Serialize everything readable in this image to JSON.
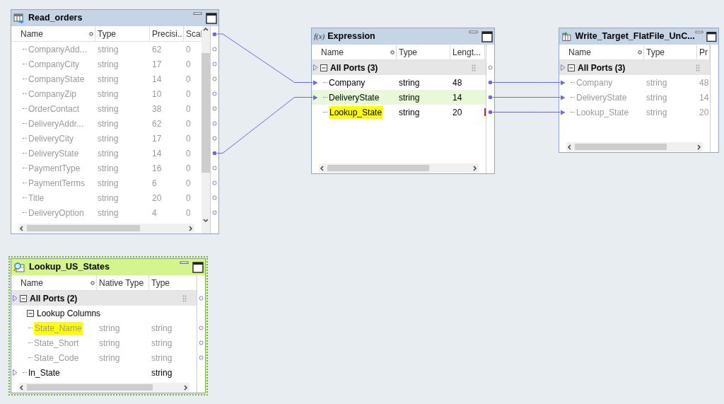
{
  "nodes": [
    {
      "kind": "source",
      "title": "Read_orders",
      "selected": false,
      "header_output_linked": true,
      "columns": [
        "Name",
        "Type",
        "Precisi...",
        "Scal"
      ],
      "rows": [
        {
          "kind": "port",
          "cells": [
            "CompanyAdd...",
            "string",
            "62",
            "0"
          ],
          "dimmed": true,
          "output": true,
          "output_linked": false
        },
        {
          "kind": "port",
          "cells": [
            "CompanyCity",
            "string",
            "17",
            "0"
          ],
          "dimmed": true,
          "output": true,
          "output_linked": false
        },
        {
          "kind": "port",
          "cells": [
            "CompanyState",
            "string",
            "14",
            "0"
          ],
          "dimmed": true,
          "output": true,
          "output_linked": false
        },
        {
          "kind": "port",
          "cells": [
            "CompanyZip",
            "string",
            "10",
            "0"
          ],
          "dimmed": true,
          "output": true,
          "output_linked": false
        },
        {
          "kind": "port",
          "cells": [
            "OrderContact",
            "string",
            "38",
            "0"
          ],
          "dimmed": true,
          "output": true,
          "output_linked": false
        },
        {
          "kind": "port",
          "cells": [
            "DeliveryAddr...",
            "string",
            "62",
            "0"
          ],
          "dimmed": true,
          "output": true,
          "output_linked": false
        },
        {
          "kind": "port",
          "cells": [
            "DeliveryCity",
            "string",
            "17",
            "0"
          ],
          "dimmed": true,
          "output": true,
          "output_linked": false
        },
        {
          "kind": "port",
          "cells": [
            "DeliveryState",
            "string",
            "14",
            "0"
          ],
          "dimmed": true,
          "output": true,
          "output_linked": true
        },
        {
          "kind": "port",
          "cells": [
            "PaymentType",
            "string",
            "16",
            "0"
          ],
          "dimmed": true,
          "output": true,
          "output_linked": false
        },
        {
          "kind": "port",
          "cells": [
            "PaymentTerms",
            "string",
            "6",
            "0"
          ],
          "dimmed": true,
          "output": true,
          "output_linked": false
        },
        {
          "kind": "port",
          "cells": [
            "Title",
            "string",
            "20",
            "0"
          ],
          "dimmed": true,
          "output": true,
          "output_linked": false
        },
        {
          "kind": "port",
          "cells": [
            "DeliveryOption",
            "string",
            "4",
            "0"
          ],
          "dimmed": true,
          "output": true,
          "output_linked": false
        }
      ]
    },
    {
      "kind": "expression",
      "title": "Expression",
      "icon_label": "f(x)",
      "selected": false,
      "columns": [
        "Name",
        "Type",
        "Lengt..."
      ],
      "rows": [
        {
          "kind": "group",
          "label": "All Ports (3)",
          "input": true,
          "input_linked": false,
          "output": true,
          "output_linked": false,
          "children": [
            {
              "kind": "port",
              "cells": [
                "Company",
                "string",
                "48"
              ],
              "input": true,
              "input_linked": true,
              "output": true,
              "output_linked": true
            },
            {
              "kind": "port",
              "cells": [
                "DeliveryState",
                "string",
                "14"
              ],
              "selected": true,
              "input": true,
              "input_linked": true,
              "output": true,
              "output_linked": true
            },
            {
              "kind": "port",
              "cells": [
                "Lookup_State",
                "string",
                "20"
              ],
              "highlighted": true,
              "error": true,
              "output": true,
              "output_linked": true
            }
          ]
        }
      ]
    },
    {
      "kind": "target",
      "title": "Write_Target_FlatFile_UnC...",
      "selected": false,
      "columns": [
        "Name",
        "Type",
        "Pr"
      ],
      "rows": [
        {
          "kind": "group",
          "label": "All Ports (3)",
          "input": true,
          "input_linked": false,
          "children": [
            {
              "kind": "port",
              "cells": [
                "Company",
                "string",
                "48"
              ],
              "dimmed": true,
              "input": true,
              "input_linked": true
            },
            {
              "kind": "port",
              "cells": [
                "DeliveryState",
                "string",
                "14"
              ],
              "dimmed": true,
              "input": true,
              "input_linked": true
            },
            {
              "kind": "port",
              "cells": [
                "Lookup_State",
                "string",
                "20"
              ],
              "dimmed": true,
              "input": true,
              "input_linked": true
            }
          ]
        }
      ]
    },
    {
      "kind": "lookup",
      "title": "Lookup_US_States",
      "selected": true,
      "columns": [
        "Name",
        "Native Type",
        "Type"
      ],
      "rows": [
        {
          "kind": "group",
          "label": "All Ports (2)",
          "input": true,
          "input_linked": false,
          "output": true,
          "output_linked": false,
          "children": [
            {
              "kind": "group",
              "label": "Lookup Columns",
              "children": [
                {
                  "kind": "port",
                  "cells": [
                    "State_Name",
                    "string",
                    "string"
                  ],
                  "dimmed": true,
                  "highlighted": true,
                  "output": true,
                  "output_linked": false
                },
                {
                  "kind": "port",
                  "cells": [
                    "State_Short",
                    "string",
                    "string"
                  ],
                  "dimmed": true,
                  "output": true,
                  "output_linked": false
                },
                {
                  "kind": "port",
                  "cells": [
                    "State_Code",
                    "string",
                    "string"
                  ],
                  "dimmed": true,
                  "output": true,
                  "output_linked": false
                }
              ]
            },
            {
              "kind": "port",
              "cells": [
                "In_State",
                "",
                "string"
              ],
              "dimmed": false,
              "input": true,
              "input_linked": false
            }
          ]
        }
      ]
    }
  ]
}
